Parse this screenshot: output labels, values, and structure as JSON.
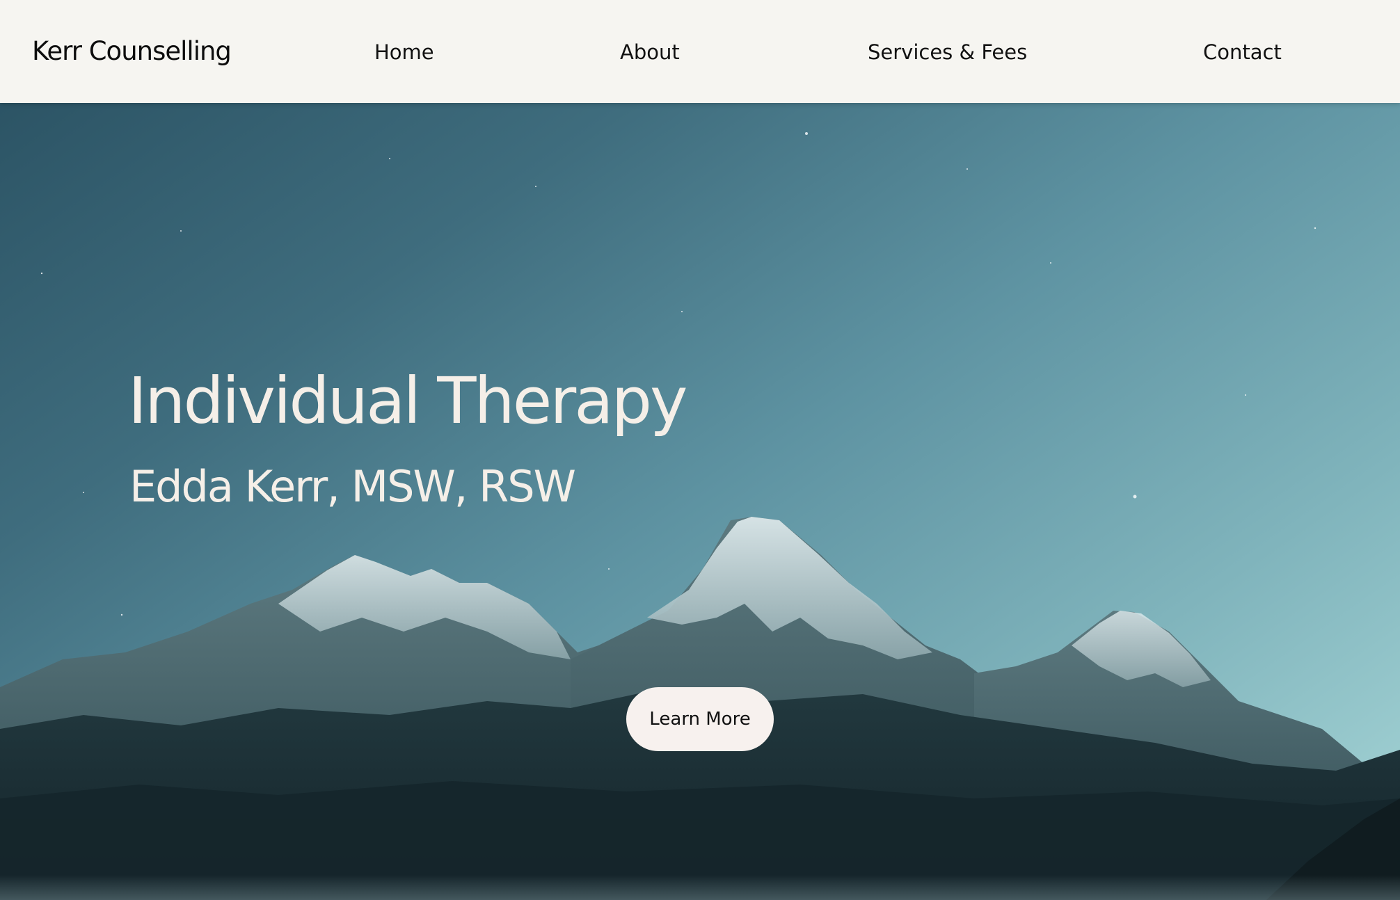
{
  "header": {
    "brand": "Kerr Counselling",
    "nav": [
      {
        "label": "Home"
      },
      {
        "label": "About"
      },
      {
        "label": "Services & Fees"
      },
      {
        "label": "Contact"
      }
    ]
  },
  "hero": {
    "title": "Individual Therapy",
    "subtitle": "Edda Kerr, MSW, RSW",
    "button_label": "Learn More",
    "background": "mountain-night-sky-image"
  },
  "colors": {
    "header_bg": "#f6f5f1",
    "text_dark": "#0d0d0d",
    "hero_text": "#f5efe8",
    "button_bg": "#f7f1ee",
    "sky_top": "#2c5465",
    "sky_bottom": "#a8d7d8"
  }
}
